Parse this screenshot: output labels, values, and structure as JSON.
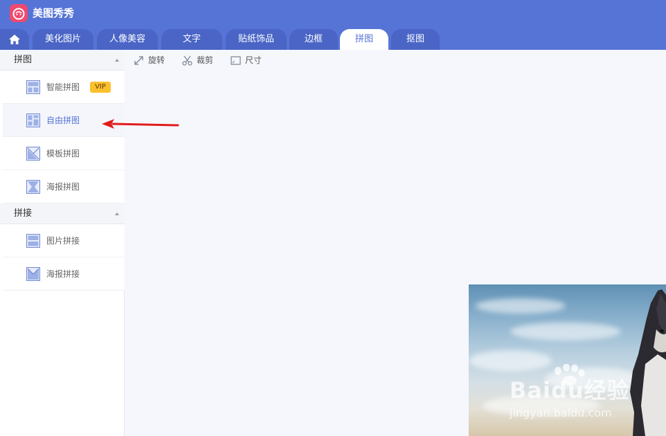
{
  "app": {
    "title": "美图秀秀"
  },
  "tabs": [
    {
      "label": "美化图片",
      "active": false
    },
    {
      "label": "人像美容",
      "active": false
    },
    {
      "label": "文字",
      "active": false
    },
    {
      "label": "贴纸饰品",
      "active": false
    },
    {
      "label": "边框",
      "active": false
    },
    {
      "label": "拼图",
      "active": true
    },
    {
      "label": "抠图",
      "active": false
    }
  ],
  "sidebar": {
    "sections": [
      {
        "title": "拼图",
        "items": [
          {
            "label": "智能拼图",
            "badge": "VIP",
            "icon": "smart-collage-icon"
          },
          {
            "label": "自由拼图",
            "icon": "free-collage-icon",
            "hovered": true
          },
          {
            "label": "模板拼图",
            "icon": "template-collage-icon"
          },
          {
            "label": "海报拼图",
            "icon": "poster-collage-icon"
          }
        ]
      },
      {
        "title": "拼接",
        "items": [
          {
            "label": "图片拼接",
            "icon": "image-stitch-icon"
          },
          {
            "label": "海报拼接",
            "icon": "poster-stitch-icon"
          }
        ]
      }
    ]
  },
  "toolbar": {
    "rotate_label": "旋转",
    "crop_label": "裁剪",
    "size_label": "尺寸"
  },
  "watermark": {
    "brand": "Baidu经验",
    "domain": "jingyan.baidu.com"
  },
  "colors": {
    "header_bg": "#5673d6",
    "accent": "#5673d6",
    "vip_badge": "#fbc02d",
    "annotation_arrow": "#e21c1c"
  }
}
